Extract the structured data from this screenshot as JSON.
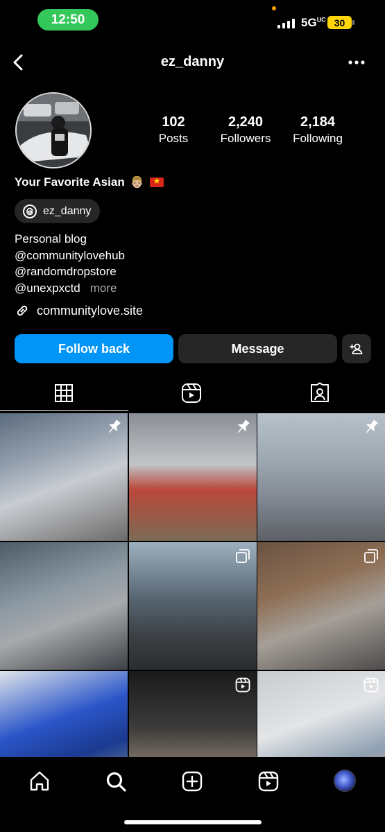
{
  "status_bar": {
    "time": "12:50",
    "network": "5G",
    "network_sup": "UC",
    "battery": "30"
  },
  "header": {
    "username": "ez_danny",
    "back_icon": "chevron-left-icon",
    "more_icon": "more-horizontal-icon"
  },
  "profile": {
    "stats": [
      {
        "count": "102",
        "label": "Posts"
      },
      {
        "count": "2,240",
        "label": "Followers"
      },
      {
        "count": "2,184",
        "label": "Following"
      }
    ],
    "display_name": "Your Favorite Asian",
    "name_emoji": "👨🏼",
    "threads_handle": "ez_danny",
    "bio_lines": [
      "Personal blog",
      "@communitylovehub",
      "@randomdropstore",
      "@unexpxctd"
    ],
    "bio_more": "more",
    "link": "communitylove.site"
  },
  "actions": {
    "follow_back": "Follow back",
    "message": "Message"
  },
  "tabs": [
    "grid-icon",
    "reels-icon",
    "tagged-icon"
  ],
  "grid": [
    {
      "badge": "pin-icon"
    },
    {
      "badge": "pin-icon"
    },
    {
      "badge": "pin-icon"
    },
    {
      "badge": ""
    },
    {
      "badge": "carousel-icon"
    },
    {
      "badge": "carousel-icon"
    },
    {
      "badge": ""
    },
    {
      "badge": "reel-icon"
    },
    {
      "badge": "reel-icon"
    }
  ],
  "bottom_nav": [
    "home-icon",
    "search-icon",
    "create-icon",
    "reels-icon",
    "profile-avatar"
  ],
  "colors": {
    "accent": "#0095f6",
    "background": "#000000",
    "button": "#262626",
    "status_green": "#34c759"
  }
}
